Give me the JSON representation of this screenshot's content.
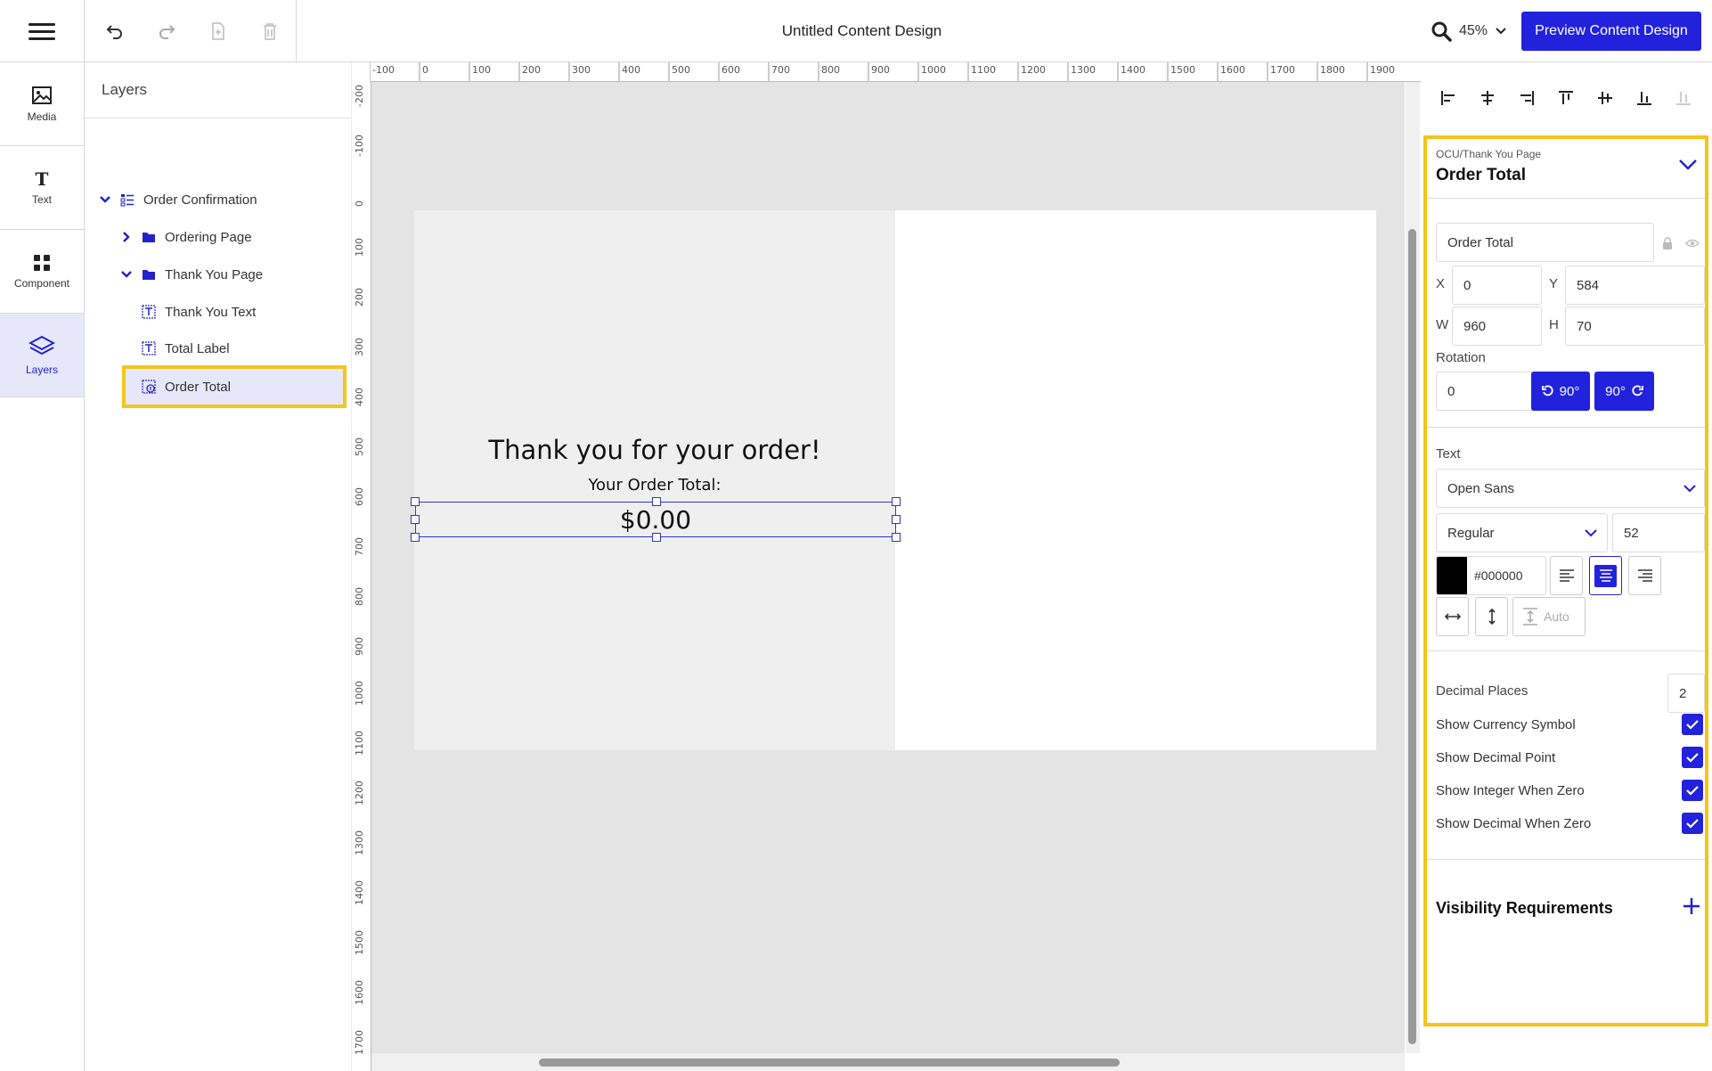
{
  "header": {
    "title": "Untitled Content Design",
    "zoom": "45%",
    "preview_label": "Preview Content Design"
  },
  "rail": {
    "items": [
      {
        "label": "Media",
        "icon": "image-icon"
      },
      {
        "label": "Text",
        "icon": "text-icon"
      },
      {
        "label": "Component",
        "icon": "grid-icon"
      },
      {
        "label": "Layers",
        "icon": "layers-icon",
        "active": true
      }
    ]
  },
  "layers": {
    "title": "Layers",
    "tree": [
      {
        "label": "Order Confirmation",
        "level": 0,
        "expanded": true
      },
      {
        "label": "Ordering Page",
        "level": 1,
        "expanded": false
      },
      {
        "label": "Thank You Page",
        "level": 1,
        "expanded": true
      },
      {
        "label": "Thank You Text",
        "level": 2
      },
      {
        "label": "Total Label",
        "level": 2
      },
      {
        "label": "Order Total",
        "level": 2,
        "selected": true
      }
    ]
  },
  "rulers": {
    "top": [
      "-100",
      "0",
      "100",
      "200",
      "300",
      "400",
      "500",
      "600",
      "700",
      "800",
      "900",
      "1000",
      "1100",
      "1200",
      "1300",
      "1400",
      "1500",
      "1600",
      "1700",
      "1800",
      "1900"
    ],
    "left": [
      "-200",
      "-100",
      "0",
      "100",
      "200",
      "300",
      "400",
      "500",
      "600",
      "700",
      "800",
      "900",
      "1000",
      "1100",
      "1200",
      "1300",
      "1400",
      "1500",
      "1600",
      "1700"
    ]
  },
  "canvas": {
    "thank_you_text": "Thank you for your order!",
    "total_label": "Your Order Total:",
    "order_total_value": "$0.00"
  },
  "properties": {
    "path": "OCU/Thank You Page",
    "title": "Order Total",
    "name_value": "Order Total",
    "x_label": "X",
    "x": "0",
    "y_label": "Y",
    "y": "584",
    "w_label": "W",
    "w": "960",
    "h_label": "H",
    "h": "70",
    "rotation_label": "Rotation",
    "rotation": "0",
    "rotate_ccw_label": "90°",
    "rotate_cw_label": "90°",
    "text_label": "Text",
    "font_family": "Open Sans",
    "font_weight": "Regular",
    "font_size": "52",
    "color_hex": "#000000",
    "color": "#000000",
    "auto_label": "Auto",
    "decimal_places_label": "Decimal Places",
    "decimal_places": "2",
    "checks": [
      {
        "label": "Show Currency Symbol",
        "checked": true
      },
      {
        "label": "Show Decimal Point",
        "checked": true
      },
      {
        "label": "Show Integer When Zero",
        "checked": true
      },
      {
        "label": "Show Decimal When Zero",
        "checked": true
      }
    ],
    "visibility_label": "Visibility Requirements"
  },
  "colors": {
    "accent": "#2222dd",
    "highlight": "#f5c518",
    "selected_bg": "#e6e8fa"
  }
}
